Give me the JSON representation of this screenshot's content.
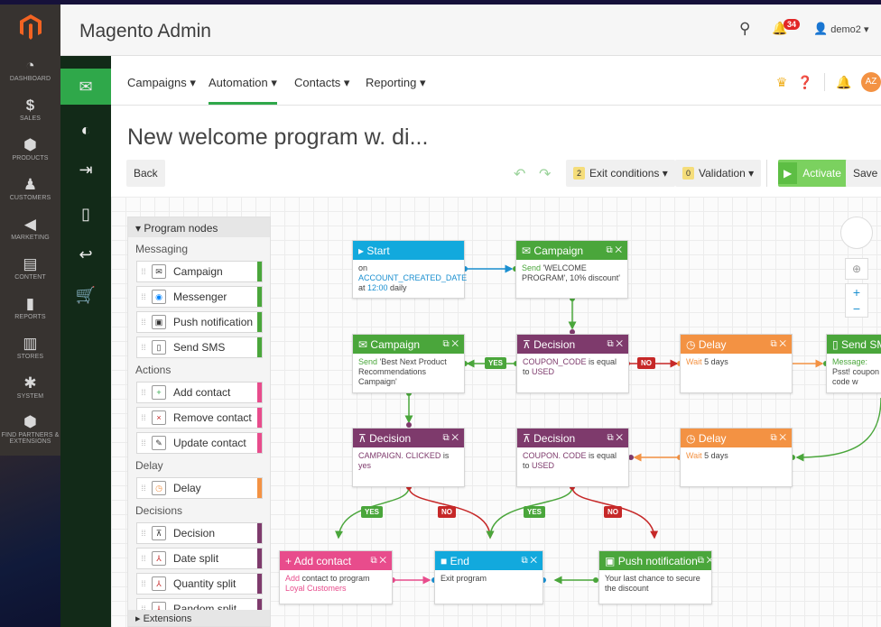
{
  "magento": {
    "sidebar": [
      {
        "label": "DASHBOARD",
        "icon": "dashboard-icon"
      },
      {
        "label": "SALES",
        "icon": "dollar-icon"
      },
      {
        "label": "PRODUCTS",
        "icon": "cube-icon"
      },
      {
        "label": "CUSTOMERS",
        "icon": "person-icon"
      },
      {
        "label": "MARKETING",
        "icon": "megaphone-icon"
      },
      {
        "label": "CONTENT",
        "icon": "layout-icon"
      },
      {
        "label": "REPORTS",
        "icon": "bar-chart-icon"
      },
      {
        "label": "STORES",
        "icon": "store-icon"
      },
      {
        "label": "SYSTEM",
        "icon": "gear-icon"
      },
      {
        "label": "FIND PARTNERS & EXTENSIONS",
        "icon": "cubes-icon"
      }
    ],
    "title": "Magento Admin",
    "notif_count": "34",
    "user": "demo2 ▾"
  },
  "app": {
    "nav": [
      "Campaigns ▾",
      "Automation ▾",
      "Contacts ▾",
      "Reporting ▾"
    ],
    "avatar": "AZ",
    "page_title": "New welcome program w. di...",
    "back": "Back",
    "exit_count": "2",
    "exit_label": "Exit conditions ▾",
    "validation_count": "0",
    "validation_label": "Validation ▾",
    "activate": "Activate",
    "save": "Save"
  },
  "palette": {
    "header": "▾ Program nodes",
    "groups": {
      "messaging": "Messaging",
      "actions": "Actions",
      "delay": "Delay",
      "decisions": "Decisions"
    },
    "items": {
      "campaign": "Campaign",
      "messenger": "Messenger",
      "push": "Push notification",
      "sms": "Send SMS",
      "add_contact": "Add contact",
      "remove_contact": "Remove contact",
      "update_contact": "Update contact",
      "delay": "Delay",
      "decision": "Decision",
      "date_split": "Date split",
      "quantity_split": "Quantity split",
      "random_split": "Random split"
    },
    "footer": "▸ Extensions"
  },
  "nodes": {
    "start": {
      "title": "Start",
      "l1": "on",
      "l2": "ACCOUNT_CREATED_DATE",
      "l3a": "at ",
      "time": "12:00",
      "l3b": " daily"
    },
    "campaign1": {
      "title": "Campaign",
      "a": "Send ",
      "b": "'WELCOME PROGRAM', 10% discount'"
    },
    "campaign2": {
      "title": "Campaign",
      "a": "Send ",
      "b": "'Best Next Product Recommendations Campaign'"
    },
    "decision1": {
      "title": "Decision",
      "a": "COUPON_CODE",
      "b": " is equal to ",
      "c": "USED"
    },
    "delay1": {
      "title": "Delay",
      "a": "Wait ",
      "b": "5 days"
    },
    "sms": {
      "title": "Send SMS",
      "a": "Message: ",
      "b": "Psst! coupon code w"
    },
    "decision2": {
      "title": "Decision",
      "a": "CAMPAIGN. CLICKED",
      "b": " is ",
      "c": "yes"
    },
    "decision3": {
      "title": "Decision",
      "a": "COUPON. CODE",
      "b": " is equal to ",
      "c": "USED"
    },
    "delay2": {
      "title": "Delay",
      "a": "Wait ",
      "b": "5 days"
    },
    "addcontact": {
      "title": "Add contact",
      "a": "Add",
      "b": " contact to program ",
      "c": "Loyal Customers"
    },
    "end": {
      "title": "End",
      "a": "Exit program"
    },
    "push": {
      "title": "Push notification",
      "a": "Your last chance to secure the discount"
    }
  },
  "tags": {
    "yes": "YES",
    "no": "NO"
  }
}
